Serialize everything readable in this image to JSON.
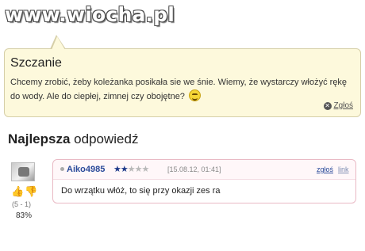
{
  "watermark": "www.wiocha.pl",
  "question": {
    "title": "Szczanie",
    "body": "Chcemy zrobić, żeby koleżanka posikała sie we śnie. Wiemy, że wystarczy włożyć rękę do wody. Ale do ciepłej, zimnej czy obojętne?",
    "emoticon": "grin-smiley-icon",
    "report_label": "Zgłoś"
  },
  "best_answer": {
    "heading_bold": "Najlepsza",
    "heading_rest": " odpowiedź"
  },
  "answer": {
    "author": "Aiko4985",
    "stars_filled": "★★",
    "stars_empty": "★★★",
    "rating": 2,
    "rating_max": 5,
    "timestamp": "[15.08.12, 01:41]",
    "report_label": "zgłoś",
    "link_label": "link",
    "text": "Do wrzątku włóż, to się przy okazji zes ra",
    "votes": "(5 - 1)",
    "percent": "83%"
  },
  "colors": {
    "question_bg": "#fdf9dc",
    "answer_border": "#e9b9c4",
    "author_link": "#2a4a9a",
    "thumb_up": "#d94a9b",
    "thumb_down": "#e6a41f"
  }
}
